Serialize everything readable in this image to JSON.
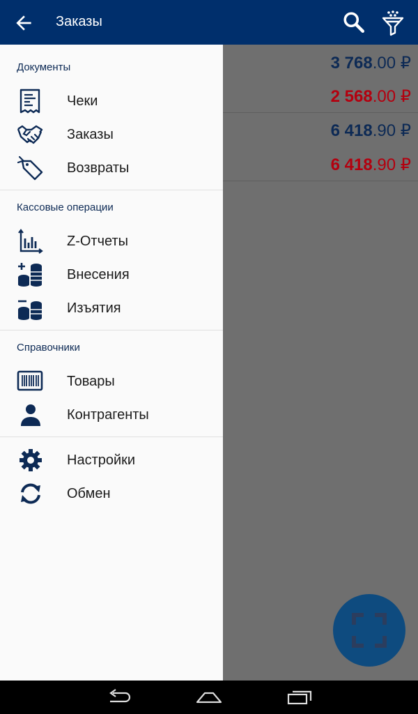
{
  "appbar": {
    "title": "Заказы"
  },
  "orders": [
    {
      "int": "3 768",
      "frac": ".00 ₽",
      "kind": "pos"
    },
    {
      "int": "2 568",
      "frac": ".00 ₽",
      "kind": "neg"
    },
    {
      "int": "6 418",
      "frac": ".90 ₽",
      "kind": "pos"
    },
    {
      "int": "6 418",
      "frac": ".90 ₽",
      "kind": "neg"
    }
  ],
  "drawer": {
    "documents": {
      "title": "Документы",
      "items": [
        {
          "label": "Чеки",
          "icon": "receipt-icon"
        },
        {
          "label": "Заказы",
          "icon": "handshake-icon"
        },
        {
          "label": "Возвраты",
          "icon": "return-tag-icon"
        }
      ]
    },
    "cash": {
      "title": "Кассовые операции",
      "items": [
        {
          "label": "Z-Отчеты",
          "icon": "chart-icon"
        },
        {
          "label": "Внесения",
          "icon": "coins-plus-icon"
        },
        {
          "label": "Изъятия",
          "icon": "coins-minus-icon"
        }
      ]
    },
    "refs": {
      "title": "Справочники",
      "items": [
        {
          "label": "Товары",
          "icon": "barcode-icon"
        },
        {
          "label": "Контрагенты",
          "icon": "person-icon"
        }
      ]
    },
    "misc": {
      "items": [
        {
          "label": "Настройки",
          "icon": "gear-icon"
        },
        {
          "label": "Обмен",
          "icon": "sync-icon"
        }
      ]
    }
  },
  "colors": {
    "primary": "#002f6c",
    "negative": "#b3000f",
    "fab": "#0e4b7f"
  }
}
